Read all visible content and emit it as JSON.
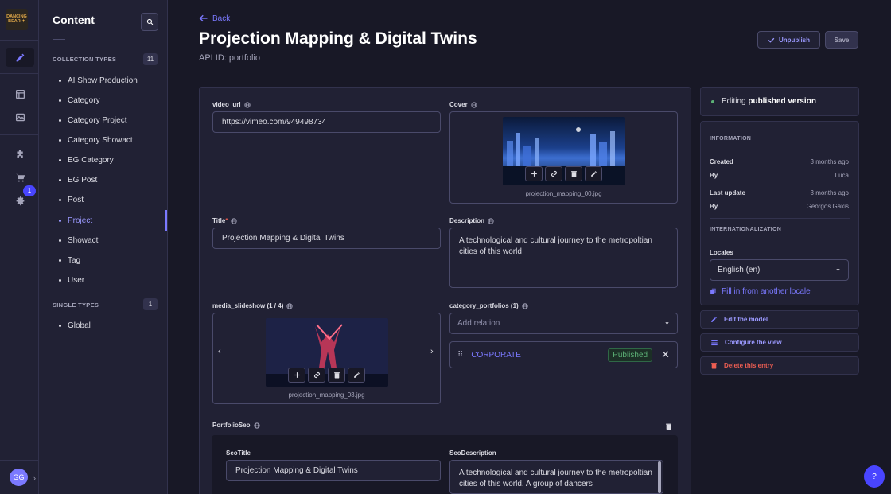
{
  "app": {
    "logo_text": "DANCING BEAR",
    "avatar_initials": "GG",
    "notification_count": "1",
    "help_label": "?"
  },
  "nav": {
    "title": "Content",
    "collection_types_label": "COLLECTION TYPES",
    "collection_types_count": "11",
    "collection_items": [
      "AI Show Production",
      "Category",
      "Category Project",
      "Category Showact",
      "EG Category",
      "EG Post",
      "Post",
      "Project",
      "Showact",
      "Tag",
      "User"
    ],
    "active_item": "Project",
    "single_types_label": "SINGLE TYPES",
    "single_types_count": "1",
    "single_items": [
      "Global"
    ]
  },
  "header": {
    "back_label": "Back",
    "title": "Projection Mapping & Digital Twins",
    "api_id": "API ID: portfolio",
    "unpublish_label": "Unpublish",
    "save_label": "Save"
  },
  "form": {
    "video_url": {
      "label": "video_url",
      "value": "https://vimeo.com/949498734"
    },
    "cover": {
      "label": "Cover",
      "filename": "projection_mapping_00.jpg"
    },
    "title": {
      "label": "Title",
      "required_mark": "*",
      "value": "Projection Mapping & Digital Twins"
    },
    "description": {
      "label": "Description",
      "value": "A technological and cultural journey to the metropoltian cities of this world"
    },
    "media_slideshow": {
      "label": "media_slideshow (1 / 4)",
      "filename": "projection_mapping_03.jpg"
    },
    "category_portfolios": {
      "label": "category_portfolios (1)",
      "placeholder": "Add relation",
      "relation_name": "CORPORATE",
      "relation_status": "Published"
    },
    "portfolio_seo": {
      "label": "PortfolioSeo",
      "seo_title_label": "SeoTitle",
      "seo_title_value": "Projection Mapping & Digital Twins",
      "seo_description_label": "SeoDescription",
      "seo_description_value": "A technological and cultural journey to the metropoltian cities of this world. A group of dancers"
    }
  },
  "side": {
    "editing_prefix": "Editing",
    "editing_strong": "published version",
    "info_heading": "INFORMATION",
    "created_label": "Created",
    "created_value": "3 months ago",
    "created_by_label": "By",
    "created_by_value": "Luca",
    "updated_label": "Last update",
    "updated_value": "3 months ago",
    "updated_by_label": "By",
    "updated_by_value": "Georgos Gakis",
    "i18n_heading": "INTERNATIONALIZATION",
    "locales_label": "Locales",
    "locale_value": "English (en)",
    "fill_label": "Fill in from another locale",
    "edit_model_label": "Edit the model",
    "configure_view_label": "Configure the view",
    "delete_label": "Delete this entry"
  },
  "colors": {
    "accent": "#7b79ff",
    "success": "#5cb176",
    "danger": "#ee5e52",
    "background": "#181826",
    "surface": "#212134"
  }
}
